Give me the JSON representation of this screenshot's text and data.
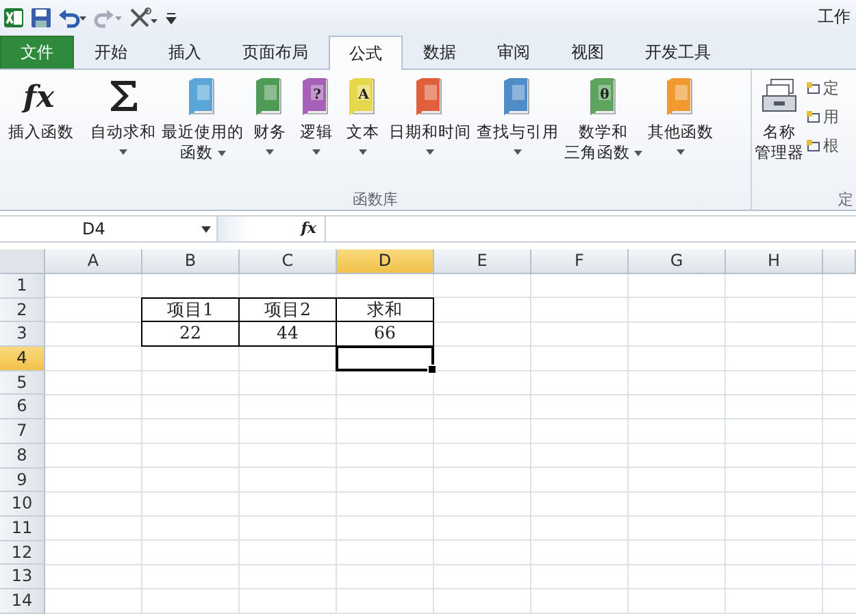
{
  "window": {
    "title": "工作"
  },
  "quick_access": [
    {
      "kind": "excel"
    },
    {
      "kind": "save"
    },
    {
      "kind": "undo"
    },
    {
      "kind": "redo"
    },
    {
      "kind": "tools"
    },
    {
      "kind": "customize"
    }
  ],
  "tabs": [
    {
      "label": "文件",
      "kind": "file",
      "selected": false
    },
    {
      "label": "开始",
      "kind": "tab",
      "selected": false
    },
    {
      "label": "插入",
      "kind": "tab",
      "selected": false
    },
    {
      "label": "页面布局",
      "kind": "tab",
      "selected": false
    },
    {
      "label": "公式",
      "kind": "tab",
      "selected": true
    },
    {
      "label": "数据",
      "kind": "tab",
      "selected": false
    },
    {
      "label": "审阅",
      "kind": "tab",
      "selected": false
    },
    {
      "label": "视图",
      "kind": "tab",
      "selected": false
    },
    {
      "label": "开发工具",
      "kind": "tab",
      "selected": false
    }
  ],
  "ribbon": {
    "groups": [
      {
        "label": "函数库",
        "items": [
          {
            "kind": "fx",
            "lines": [
              "插入函数"
            ],
            "dropdown": false
          },
          {
            "kind": "sigma",
            "lines": [
              "自动求和"
            ],
            "dropdown": true
          },
          {
            "kind": "book",
            "color": "#5aa6d8",
            "lines": [
              "最近使用的",
              "函数"
            ],
            "dropdown": true
          },
          {
            "kind": "book",
            "color": "#4f9a55",
            "lines": [
              "财务"
            ],
            "dropdown": true
          },
          {
            "kind": "book",
            "color": "#a760b8",
            "glyph": "?",
            "lines": [
              "逻辑"
            ],
            "dropdown": true
          },
          {
            "kind": "book",
            "color": "#e6d84a",
            "glyph": "A",
            "lines": [
              "文本"
            ],
            "dropdown": true
          },
          {
            "kind": "book",
            "color": "#e0603c",
            "lines": [
              "日期和时间"
            ],
            "dropdown": true
          },
          {
            "kind": "book",
            "color": "#4f8cc8",
            "lines": [
              "查找与引用"
            ],
            "dropdown": true
          },
          {
            "kind": "book",
            "color": "#5ea35e",
            "glyph": "θ",
            "lines": [
              "数学和",
              "三角函数"
            ],
            "dropdown": true
          },
          {
            "kind": "book",
            "color": "#f09a30",
            "lines": [
              "其他函数"
            ],
            "dropdown": true
          }
        ]
      },
      {
        "label": "定",
        "items": [
          {
            "kind": "manager",
            "lines": [
              "名称",
              "管理器"
            ],
            "dropdown": false
          }
        ],
        "small_items": [
          {
            "label": "定"
          },
          {
            "label": "用"
          },
          {
            "label": "根"
          }
        ]
      }
    ]
  },
  "formula_bar": {
    "name_box": "D4",
    "fx": "fx"
  },
  "columns": [
    {
      "label": "A",
      "selected": false
    },
    {
      "label": "B",
      "selected": false
    },
    {
      "label": "C",
      "selected": false
    },
    {
      "label": "D",
      "selected": true
    },
    {
      "label": "E",
      "selected": false
    },
    {
      "label": "F",
      "selected": false
    },
    {
      "label": "G",
      "selected": false
    },
    {
      "label": "H",
      "selected": false
    }
  ],
  "rows": [
    {
      "label": "1",
      "selected": false
    },
    {
      "label": "2",
      "selected": false
    },
    {
      "label": "3",
      "selected": false
    },
    {
      "label": "4",
      "selected": true
    },
    {
      "label": "5",
      "selected": false
    },
    {
      "label": "6",
      "selected": false
    },
    {
      "label": "7",
      "selected": false
    },
    {
      "label": "8",
      "selected": false
    },
    {
      "label": "9",
      "selected": false
    },
    {
      "label": "10",
      "selected": false
    },
    {
      "label": "11",
      "selected": false
    },
    {
      "label": "12",
      "selected": false
    },
    {
      "label": "13",
      "selected": false
    },
    {
      "label": "14",
      "selected": false
    }
  ],
  "table": {
    "header": [
      "项目1",
      "项目2",
      "求和"
    ],
    "rows": [
      [
        "22",
        "44",
        "66"
      ]
    ]
  }
}
